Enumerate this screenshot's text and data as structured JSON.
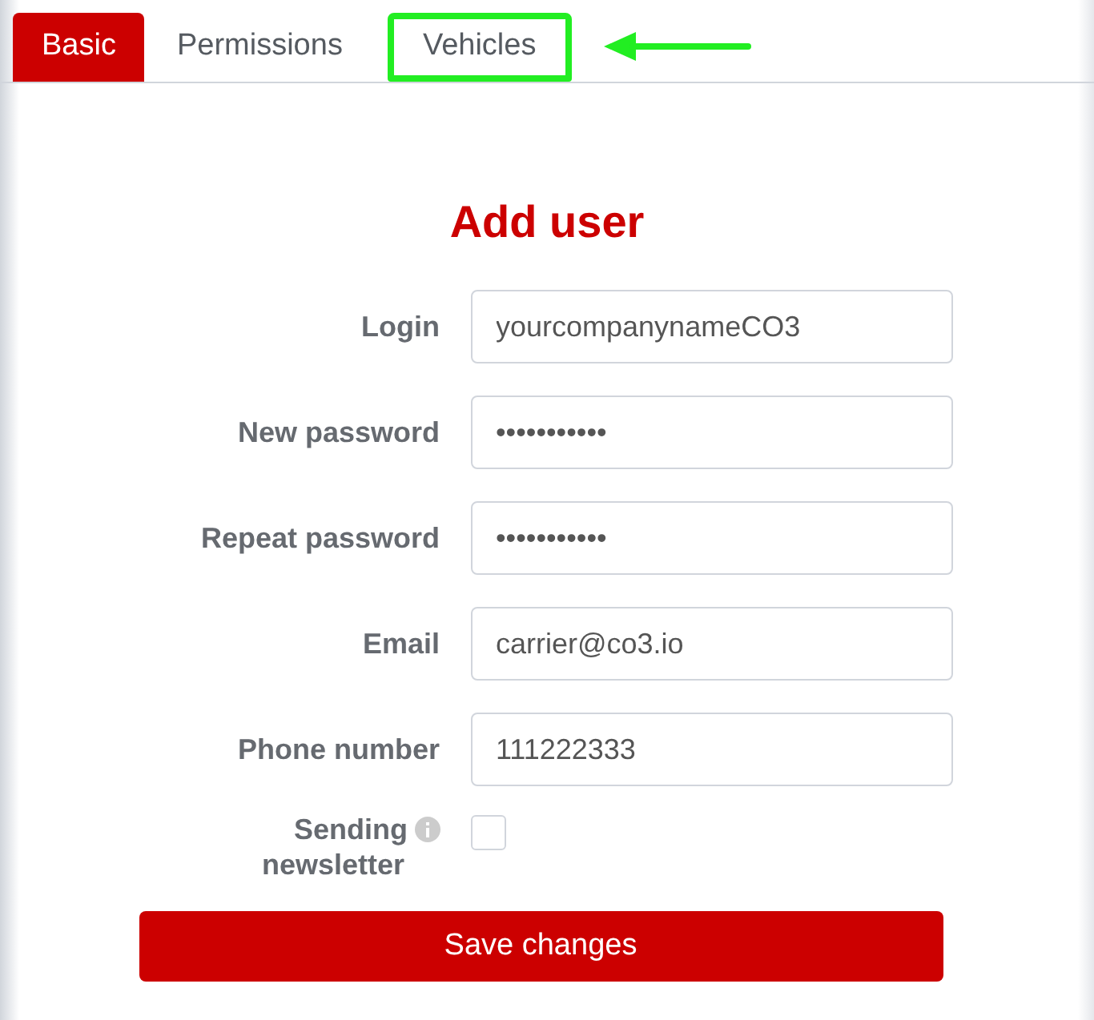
{
  "tabs": [
    {
      "label": "Basic",
      "selected": true,
      "highlighted": false
    },
    {
      "label": "Permissions",
      "selected": false,
      "highlighted": false
    },
    {
      "label": "Vehicles",
      "selected": false,
      "highlighted": true
    }
  ],
  "form": {
    "title": "Add user",
    "fields": [
      {
        "label": "Login",
        "value": "yourcompanynameCO3"
      },
      {
        "label": "New password",
        "value": "•••••••••••"
      },
      {
        "label": "Repeat password",
        "value": "•••••••••••"
      },
      {
        "label": "Email",
        "value": "carrier@co3.io"
      },
      {
        "label": "Phone number",
        "value": "111222333"
      }
    ],
    "newsletter": {
      "label_line_1": "Sending",
      "label_line_2": "newsletter",
      "checked": false
    },
    "save_button": "Save changes"
  }
}
